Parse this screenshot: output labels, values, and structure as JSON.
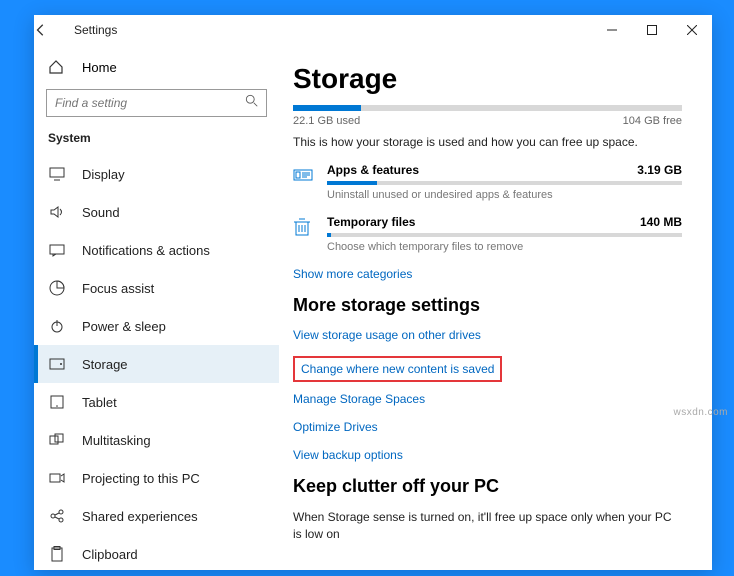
{
  "app_title": "Settings",
  "search_placeholder": "Find a setting",
  "home_label": "Home",
  "sidebar_section": "System",
  "nav": [
    {
      "label": "Display"
    },
    {
      "label": "Sound"
    },
    {
      "label": "Notifications & actions"
    },
    {
      "label": "Focus assist"
    },
    {
      "label": "Power & sleep"
    },
    {
      "label": "Storage"
    },
    {
      "label": "Tablet"
    },
    {
      "label": "Multitasking"
    },
    {
      "label": "Projecting to this PC"
    },
    {
      "label": "Shared experiences"
    },
    {
      "label": "Clipboard"
    }
  ],
  "page_title": "Storage",
  "used": "22.1 GB used",
  "free": "104 GB free",
  "usage_desc": "This is how your storage is used and how you can free up space.",
  "cats": [
    {
      "name": "Apps & features",
      "size": "3.19 GB",
      "sub": "Uninstall unused or undesired apps & features",
      "pct": 14
    },
    {
      "name": "Temporary files",
      "size": "140 MB",
      "sub": "Choose which temporary files to remove",
      "pct": 1
    }
  ],
  "show_more": "Show more categories",
  "more_heading": "More storage settings",
  "more_links": [
    "View storage usage on other drives",
    "Change where new content is saved",
    "Manage Storage Spaces",
    "Optimize Drives",
    "View backup options"
  ],
  "keep_heading": "Keep clutter off your PC",
  "keep_desc": "When Storage sense is turned on, it'll free up space only when your PC is low on",
  "watermark": "wsxdn.com",
  "chart_data": {
    "type": "bar",
    "title": "Storage",
    "categories": [
      "Used",
      "Free"
    ],
    "values": [
      22.1,
      104
    ],
    "unit": "GB",
    "series": [
      {
        "name": "Apps & features",
        "values": [
          3.19
        ],
        "unit": "GB"
      },
      {
        "name": "Temporary files",
        "values": [
          0.14
        ],
        "unit": "GB"
      }
    ]
  }
}
